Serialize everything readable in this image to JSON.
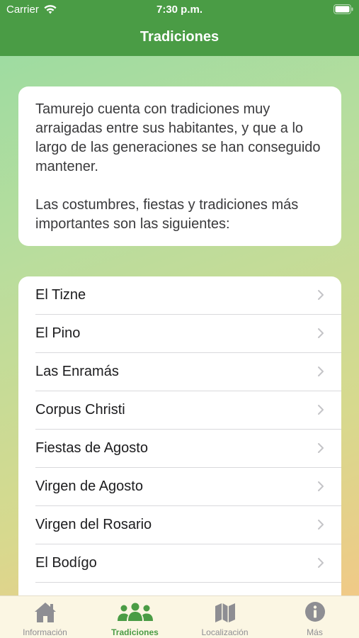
{
  "status_bar": {
    "carrier": "Carrier",
    "time": "7:30 p.m.",
    "icons": [
      "wifi-icon",
      "battery-icon"
    ]
  },
  "nav": {
    "title": "Tradiciones"
  },
  "intro": {
    "paragraph1": "Tamurejo cuenta con tradiciones muy arraigadas entre sus habitantes, y que a lo largo de las generaciones se han conseguido mantener.",
    "paragraph2": "Las costumbres, fiestas y tradiciones más importantes son las siguientes:"
  },
  "traditions": [
    {
      "label": "El Tizne"
    },
    {
      "label": "El Pino"
    },
    {
      "label": "Las Enramás"
    },
    {
      "label": "Corpus Christi"
    },
    {
      "label": "Fiestas de Agosto"
    },
    {
      "label": "Virgen de Agosto"
    },
    {
      "label": "Virgen del Rosario"
    },
    {
      "label": "El Bodígo"
    }
  ],
  "tabs": [
    {
      "label": "Información",
      "icon": "house-icon",
      "active": false
    },
    {
      "label": "Tradiciones",
      "icon": "people-icon",
      "active": true
    },
    {
      "label": "Localización",
      "icon": "map-icon",
      "active": false
    },
    {
      "label": "Más",
      "icon": "info-icon",
      "active": false
    }
  ],
  "colors": {
    "accent": "#4a9c45",
    "inactive_tab": "#8e8e93",
    "tabbar_bg": "#fbf6e3"
  }
}
